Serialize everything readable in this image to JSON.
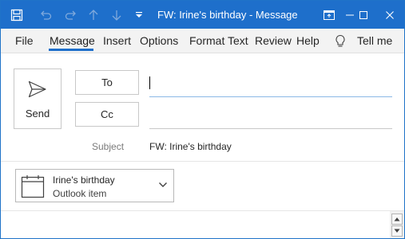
{
  "window": {
    "title": "FW: Irine's birthday  -  Message"
  },
  "titlebar": {
    "icons": [
      "save-icon",
      "undo-icon",
      "redo-icon",
      "up-arrow-icon",
      "down-arrow-icon",
      "customize-toolbar-icon"
    ],
    "controls": [
      "ribbon-display-options-icon",
      "minimize-icon",
      "maximize-icon",
      "close-icon"
    ]
  },
  "menu": {
    "items": [
      "File",
      "Message",
      "Insert",
      "Options",
      "Format Text",
      "Review",
      "Help",
      "Tell me"
    ],
    "active": "Message"
  },
  "compose": {
    "send_label": "Send",
    "to_label": "To",
    "cc_label": "Cc",
    "to_value": "",
    "cc_value": "",
    "subject_label": "Subject",
    "subject_value": "FW: Irine's birthday"
  },
  "attachment": {
    "name": "Irine's birthday",
    "type": "Outlook item",
    "icon": "calendar-icon"
  },
  "colors": {
    "titlebar": "#1e6fcb",
    "accent": "#1e6fcb",
    "menubar": "#f3f3f3"
  }
}
